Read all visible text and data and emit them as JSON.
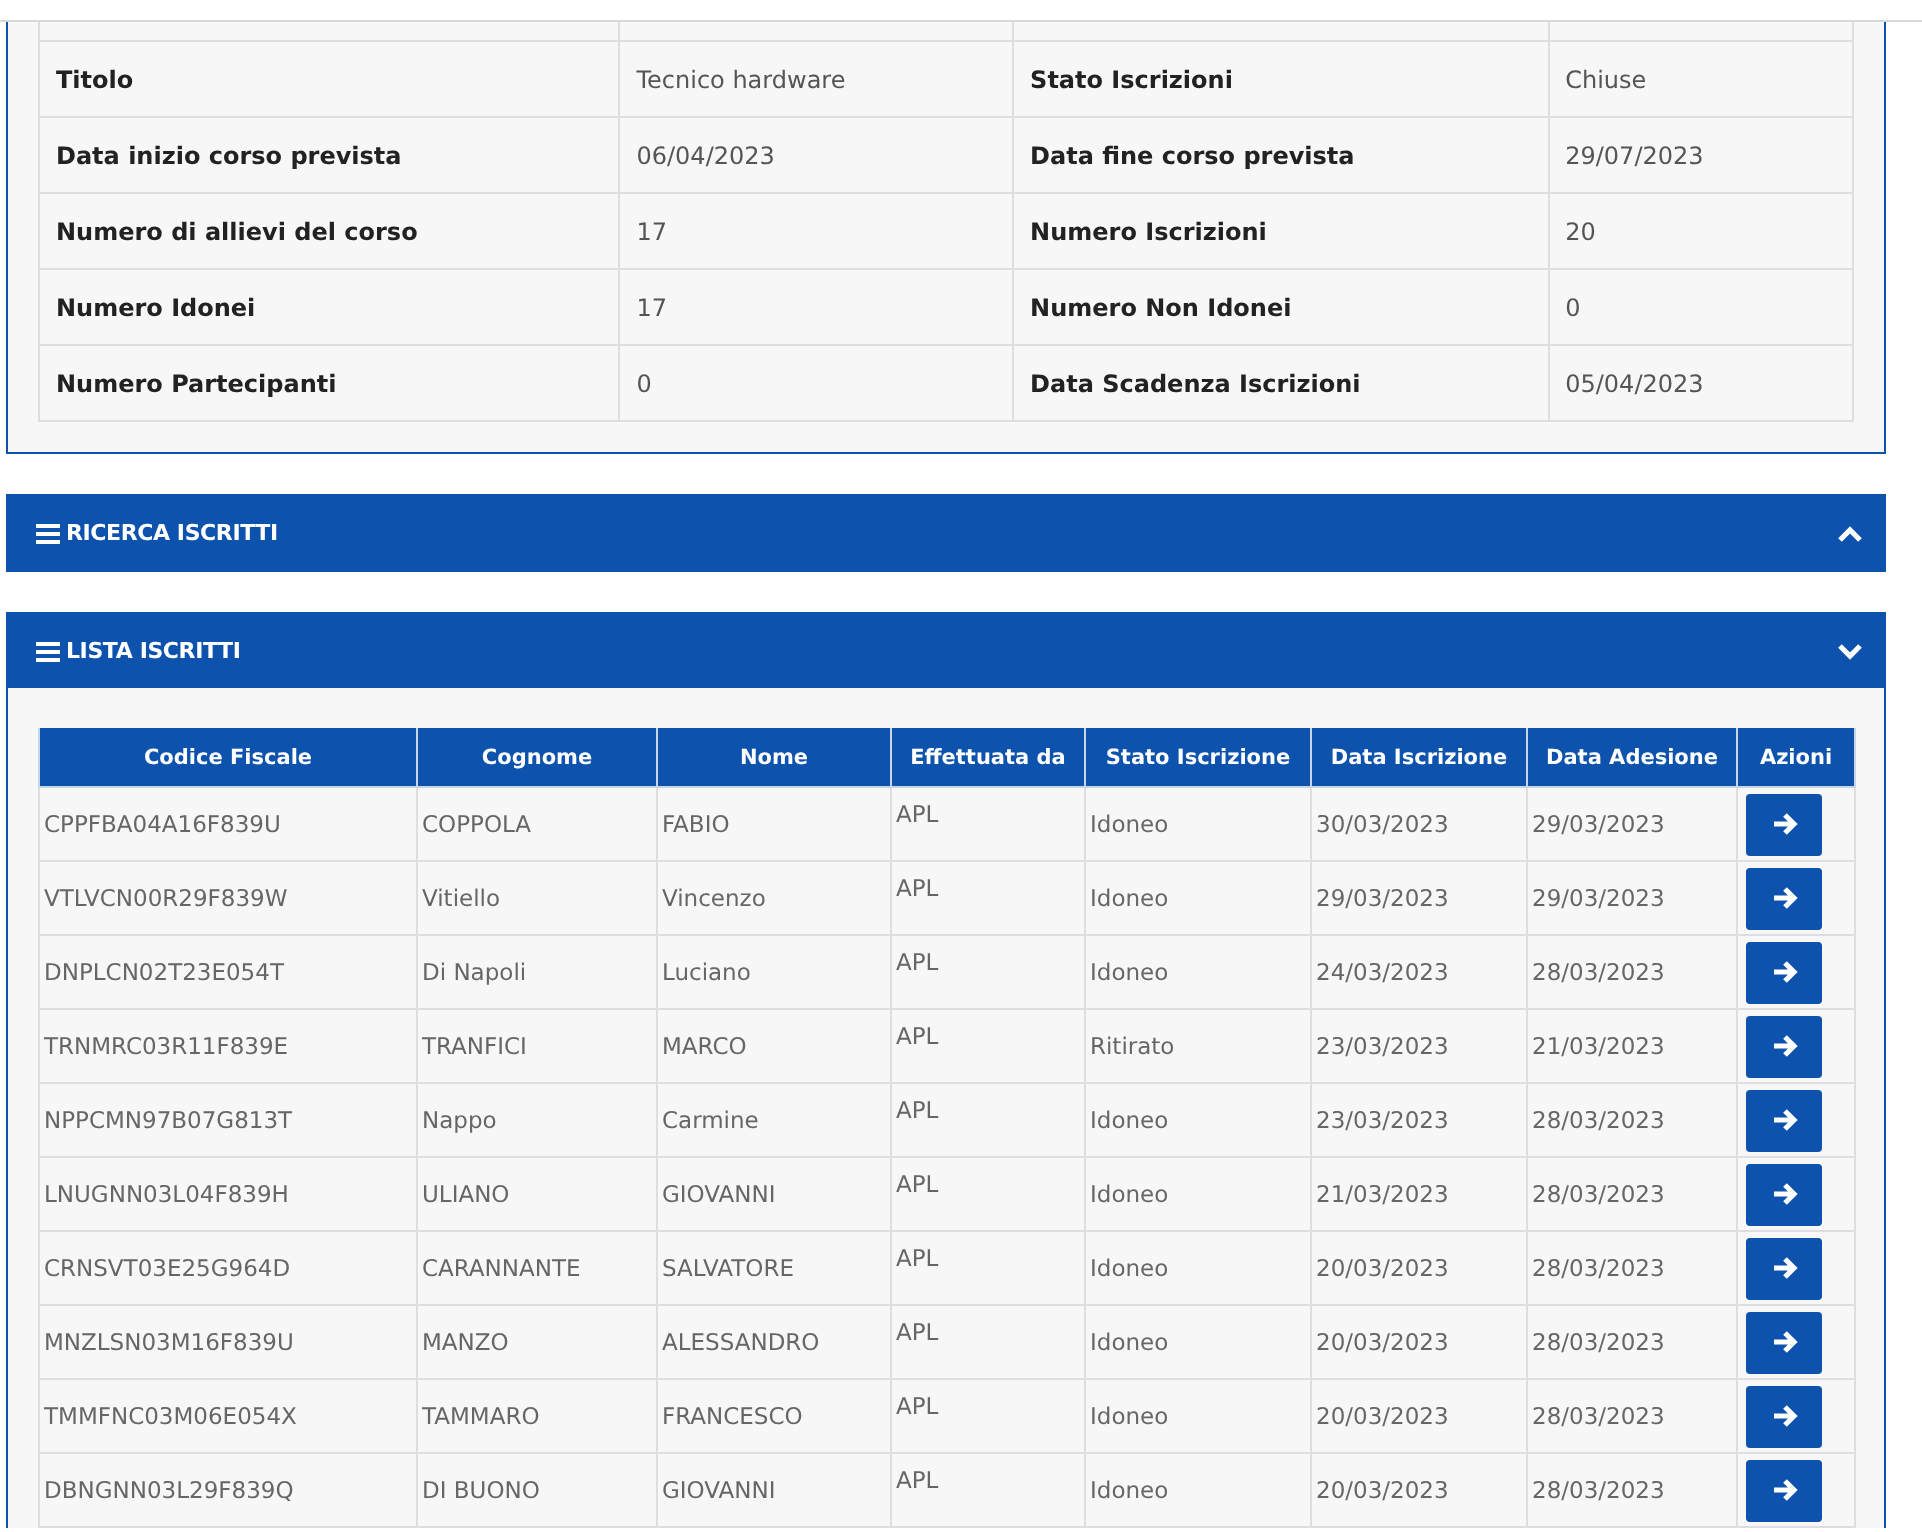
{
  "course_details": [
    {
      "label": "Titolo",
      "value": "Tecnico hardware",
      "label_2": "Stato Iscrizioni",
      "value_2": "Chiuse"
    },
    {
      "label": "Data inizio corso prevista",
      "value": "06/04/2023",
      "label_2": "Data fine corso prevista",
      "value_2": "29/07/2023"
    },
    {
      "label": "Numero di allievi del corso",
      "value": "17",
      "label_2": "Numero Iscrizioni",
      "value_2": "20"
    },
    {
      "label": "Numero Idonei",
      "value": "17",
      "label_2": "Numero Non Idonei",
      "value_2": "0"
    },
    {
      "label": "Numero Partecipanti",
      "value": "0",
      "label_2": "Data Scadenza Iscrizioni",
      "value_2": "05/04/2023"
    }
  ],
  "panels": [
    {
      "title": "RICERCA ISCRITTI",
      "expanded": false
    },
    {
      "title": "LISTA ISCRITTI",
      "expanded": true
    }
  ],
  "table": {
    "columns": [
      "Codice Fiscale",
      "Cognome",
      "Nome",
      "Effettuata da",
      "Stato Iscrizione",
      "Data Iscrizione",
      "Data Adesione",
      "Azioni"
    ],
    "rows": [
      [
        "CPPFBA04A16F839U",
        "COPPOLA",
        "FABIO",
        "APL",
        "Idoneo",
        "30/03/2023",
        "29/03/2023"
      ],
      [
        "VTLVCN00R29F839W",
        "Vitiello",
        "Vincenzo",
        "APL",
        "Idoneo",
        "29/03/2023",
        "29/03/2023"
      ],
      [
        "DNPLCN02T23E054T",
        "Di Napoli",
        "Luciano",
        "APL",
        "Idoneo",
        "24/03/2023",
        "28/03/2023"
      ],
      [
        "TRNMRC03R11F839E",
        "TRANFICI",
        "MARCO",
        "APL",
        "Ritirato",
        "23/03/2023",
        "21/03/2023"
      ],
      [
        "NPPCMN97B07G813T",
        "Nappo",
        "Carmine",
        "APL",
        "Idoneo",
        "23/03/2023",
        "28/03/2023"
      ],
      [
        "LNUGNN03L04F839H",
        "ULIANO",
        "GIOVANNI",
        "APL",
        "Idoneo",
        "21/03/2023",
        "28/03/2023"
      ],
      [
        "CRNSVT03E25G964D",
        "CARANNANTE",
        "SALVATORE",
        "APL",
        "Idoneo",
        "20/03/2023",
        "28/03/2023"
      ],
      [
        "MNZLSN03M16F839U",
        "MANZO",
        "ALESSANDRO",
        "APL",
        "Idoneo",
        "20/03/2023",
        "28/03/2023"
      ],
      [
        "TMMFNC03M06E054X",
        "TAMMARO",
        "FRANCESCO",
        "APL",
        "Idoneo",
        "20/03/2023",
        "28/03/2023"
      ],
      [
        "DBNGNN03L29F839Q",
        "DI BUONO",
        "GIOVANNI",
        "APL",
        "Idoneo",
        "20/03/2023",
        "28/03/2023"
      ]
    ]
  }
}
